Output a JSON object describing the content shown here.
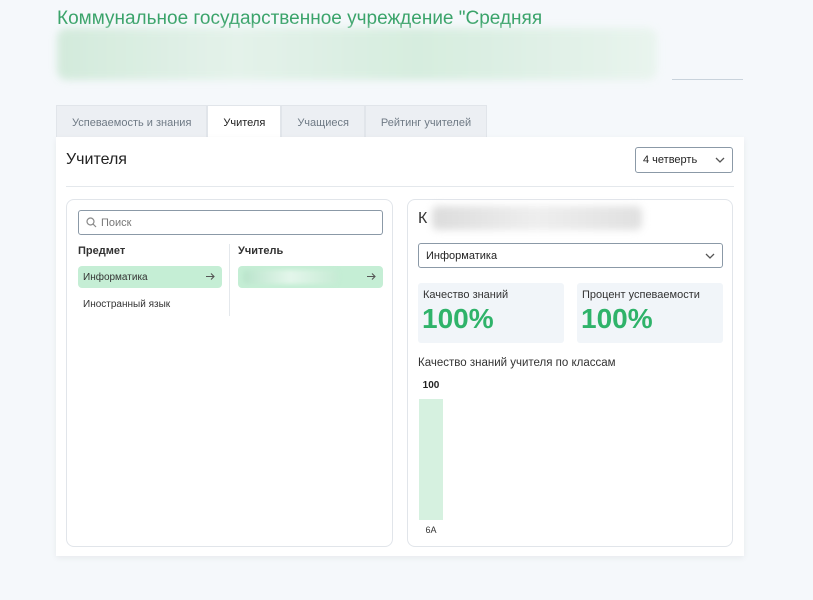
{
  "header": {
    "org_title": "Коммунальное государственное учреждение \"Средняя"
  },
  "tabs": [
    {
      "label": "Успеваемость и знания",
      "active": false
    },
    {
      "label": "Учителя",
      "active": true
    },
    {
      "label": "Учащиеся",
      "active": false
    },
    {
      "label": "Рейтинг учителей",
      "active": false
    }
  ],
  "panel": {
    "title": "Учителя",
    "quarter_select": "4 четверть"
  },
  "left": {
    "search_placeholder": "Поиск",
    "subject_header": "Предмет",
    "teacher_header": "Учитель",
    "subjects": [
      {
        "label": "Информатика",
        "active": true
      },
      {
        "label": "Иностранный язык",
        "active": false
      }
    ]
  },
  "right": {
    "teacher_initial": "К",
    "subject_select": "Информатика",
    "stats": [
      {
        "label": "Качество знаний",
        "value": "100%"
      },
      {
        "label": "Процент успеваемости",
        "value": "100%"
      }
    ]
  },
  "chart_data": {
    "type": "bar",
    "title": "Качество знаний учителя по классам",
    "categories": [
      "6А"
    ],
    "values": [
      100
    ],
    "value_labels": [
      "100"
    ],
    "ylim": [
      0,
      100
    ],
    "bar_color": "#d6f1e0"
  },
  "colors": {
    "accent": "#2fb36a",
    "active_item": "#c5eed5"
  }
}
